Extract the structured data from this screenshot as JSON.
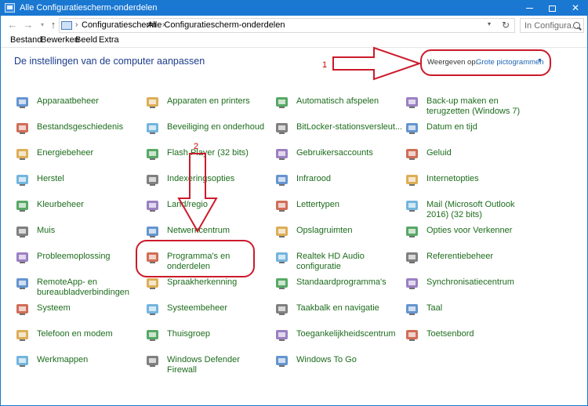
{
  "window": {
    "title": "Alle Configuratiescherm-onderdelen",
    "buttons": {
      "minimize": "minimize-icon",
      "maximize": "maximize-icon",
      "close": "✕"
    }
  },
  "address": {
    "crumbs": [
      "Configuratiescherm",
      "Alle Configuratiescherm-onderdelen"
    ],
    "search_placeholder": "In Configura..."
  },
  "menu": [
    "Bestand",
    "Bewerken",
    "Beeld",
    "Extra"
  ],
  "heading": "De instellingen van de computer aanpassen",
  "view_by": {
    "label": "Weergeven op:",
    "value": "Grote pictogrammen"
  },
  "annotations": {
    "one": "1",
    "two": "2",
    "color": "#cc1a2a"
  },
  "colors": {
    "titlebar": "#1a78d2",
    "link": "#1d6c1d",
    "heading": "#1c3c8c"
  },
  "items": [
    [
      "Apparaatbeheer",
      "Apparaten en printers",
      "Automatisch afspelen",
      "Back-up maken en\nterugzetten (Windows 7)"
    ],
    [
      "Bestandsgeschiedenis",
      "Beveiliging en onderhoud",
      "BitLocker-stationsversleut...",
      "Datum en tijd"
    ],
    [
      "Energiebeheer",
      "Flash Player (32 bits)",
      "Gebruikersaccounts",
      "Geluid"
    ],
    [
      "Herstel",
      "Indexeringsopties",
      "Infrarood",
      "Internetopties"
    ],
    [
      "Kleurbeheer",
      "Land/regio",
      "Lettertypen",
      "Mail (Microsoft Outlook\n2016) (32 bits)"
    ],
    [
      "Muis",
      "Netwerkcentrum",
      "Opslagruimten",
      "Opties voor Verkenner"
    ],
    [
      "Probleemoplossing",
      "Programma's en\nonderdelen",
      "Realtek HD Audio\nconfiguratie",
      "Referentiebeheer"
    ],
    [
      "RemoteApp- en\nbureaubladverbindingen",
      "Spraakherkenning",
      "Standaardprogramma's",
      "Synchronisatiecentrum"
    ],
    [
      "Systeem",
      "Systeembeheer",
      "Taakbalk en navigatie",
      "Taal"
    ],
    [
      "Telefoon en modem",
      "Thuisgroep",
      "Toegankelijkheidscentrum",
      "Toetsenbord"
    ],
    [
      "Werkmappen",
      "Windows Defender\nFirewall",
      "Windows To Go",
      ""
    ]
  ],
  "icons": [
    [
      "device-manager-icon",
      "devices-printers-icon",
      "autoplay-icon",
      "backup-restore-icon"
    ],
    [
      "file-history-icon",
      "security-maintenance-icon",
      "bitlocker-icon",
      "date-time-icon"
    ],
    [
      "power-options-icon",
      "flash-player-icon",
      "user-accounts-icon",
      "sound-icon"
    ],
    [
      "recovery-icon",
      "indexing-options-icon",
      "infrared-icon",
      "internet-options-icon"
    ],
    [
      "color-management-icon",
      "region-icon",
      "fonts-icon",
      "mail-icon"
    ],
    [
      "mouse-icon",
      "network-center-icon",
      "storage-spaces-icon",
      "explorer-options-icon"
    ],
    [
      "troubleshooting-icon",
      "programs-features-icon",
      "realtek-audio-icon",
      "credential-manager-icon"
    ],
    [
      "remoteapp-icon",
      "speech-recognition-icon",
      "default-programs-icon",
      "sync-center-icon"
    ],
    [
      "system-icon",
      "admin-tools-icon",
      "taskbar-navigation-icon",
      "language-icon"
    ],
    [
      "phone-modem-icon",
      "homegroup-icon",
      "ease-of-access-icon",
      "keyboard-icon"
    ],
    [
      "work-folders-icon",
      "firewall-icon",
      "windows-to-go-icon",
      ""
    ]
  ]
}
